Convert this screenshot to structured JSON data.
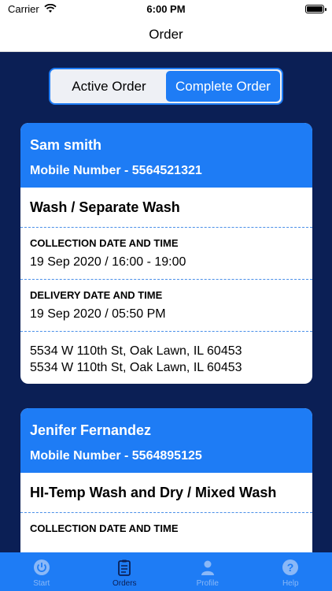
{
  "status": {
    "carrier": "Carrier",
    "time": "6:00 PM"
  },
  "nav": {
    "title": "Order"
  },
  "segment": {
    "active_label": "Active Order",
    "complete_label": "Complete Order",
    "selected": "Complete Order"
  },
  "orders": [
    {
      "name": "Sam smith",
      "mobile": "Mobile Number - 5564521321",
      "service": "Wash / Separate Wash",
      "collection_label": "COLLECTION DATE AND TIME",
      "collection_value": "19 Sep 2020 / 16:00 - 19:00",
      "delivery_label": "DELIVERY DATE AND TIME",
      "delivery_value": "19 Sep 2020 / 05:50 PM",
      "address_line1": "5534 W 110th St, Oak Lawn, IL 60453",
      "address_line2": "5534 W 110th St, Oak Lawn, IL 60453"
    },
    {
      "name": "Jenifer Fernandez",
      "mobile": "Mobile Number - 5564895125",
      "service": "HI-Temp Wash and Dry / Mixed Wash",
      "collection_label": "COLLECTION DATE AND TIME"
    }
  ],
  "tabs": [
    {
      "label": "Start",
      "icon": "power-icon"
    },
    {
      "label": "Orders",
      "icon": "clipboard-icon"
    },
    {
      "label": "Profile",
      "icon": "person-icon"
    },
    {
      "label": "Help",
      "icon": "question-icon"
    }
  ],
  "colors": {
    "accent": "#1e7cf5",
    "background": "#0b1f55",
    "card": "#ffffff"
  }
}
